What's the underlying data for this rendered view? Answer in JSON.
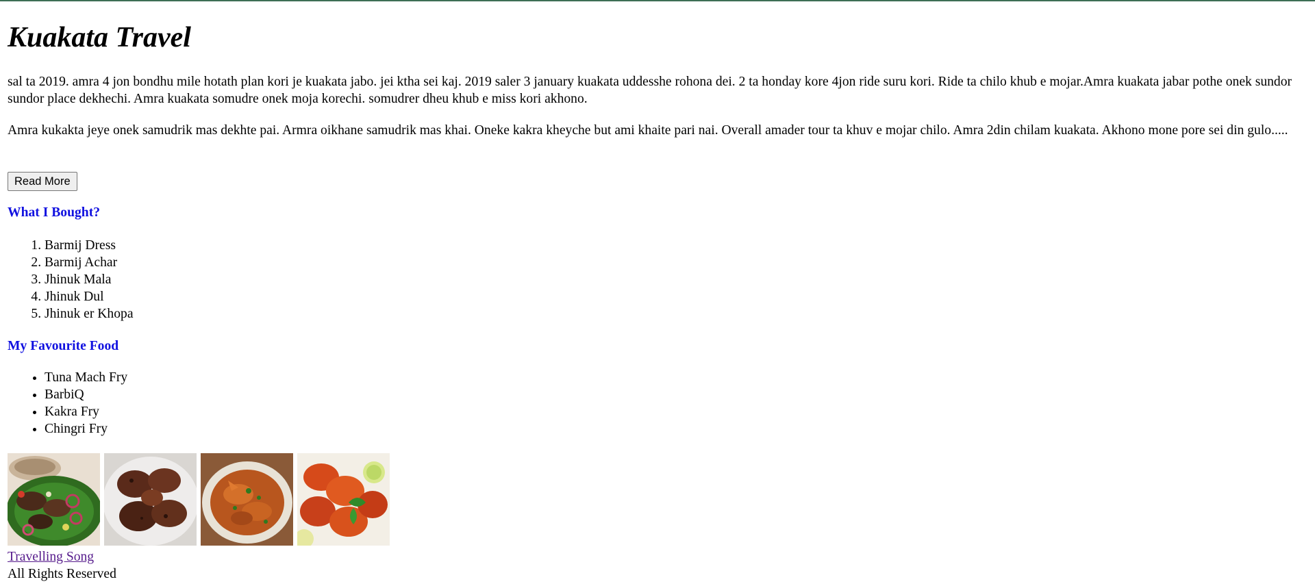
{
  "page": {
    "title": "Kuakata Travel",
    "paragraphs": [
      "sal ta 2019. amra 4 jon bondhu mile hotath plan kori je kuakata jabo. jei ktha sei kaj. 2019 saler 3 january kuakata uddesshe rohona dei. 2 ta honday kore 4jon ride suru kori. Ride ta chilo khub e mojar.Amra kuakata jabar pothe onek sundor sundor place dekhechi. Amra kuakata somudre onek moja korechi. somudrer dheu khub e miss kori akhono.",
      "Amra kukakta jeye onek samudrik mas dekhte pai. Armra oikhane samudrik mas khai. Oneke kakra kheyche but ami khaite pari nai. Overall amader tour ta khuv e mojar chilo. Amra 2din chilam kuakata. Akhono mone pore sei din gulo....."
    ],
    "read_more_label": "Read More",
    "bought": {
      "heading": "What I Bought?",
      "items": [
        "Barmij Dress",
        "Barmij Achar",
        "Jhinuk Mala",
        "Jhinuk Dul",
        "Jhinuk er Khopa"
      ]
    },
    "food": {
      "heading": "My Favourite Food",
      "items": [
        "Tuna Mach Fry",
        "BarbiQ",
        "Kakra Fry",
        "Chingri Fry"
      ]
    },
    "gallery": [
      {
        "icon": "grilled-fish-plate-image"
      },
      {
        "icon": "grilled-chicken-image"
      },
      {
        "icon": "crab-curry-image"
      },
      {
        "icon": "fried-prawns-image"
      }
    ],
    "song_link": "Travelling Song",
    "footer": "All Rights Reserved"
  },
  "colors": {
    "heading_blue": "#1010e0",
    "visited_link": "#551a8b",
    "top_border": "#3d6e55"
  }
}
